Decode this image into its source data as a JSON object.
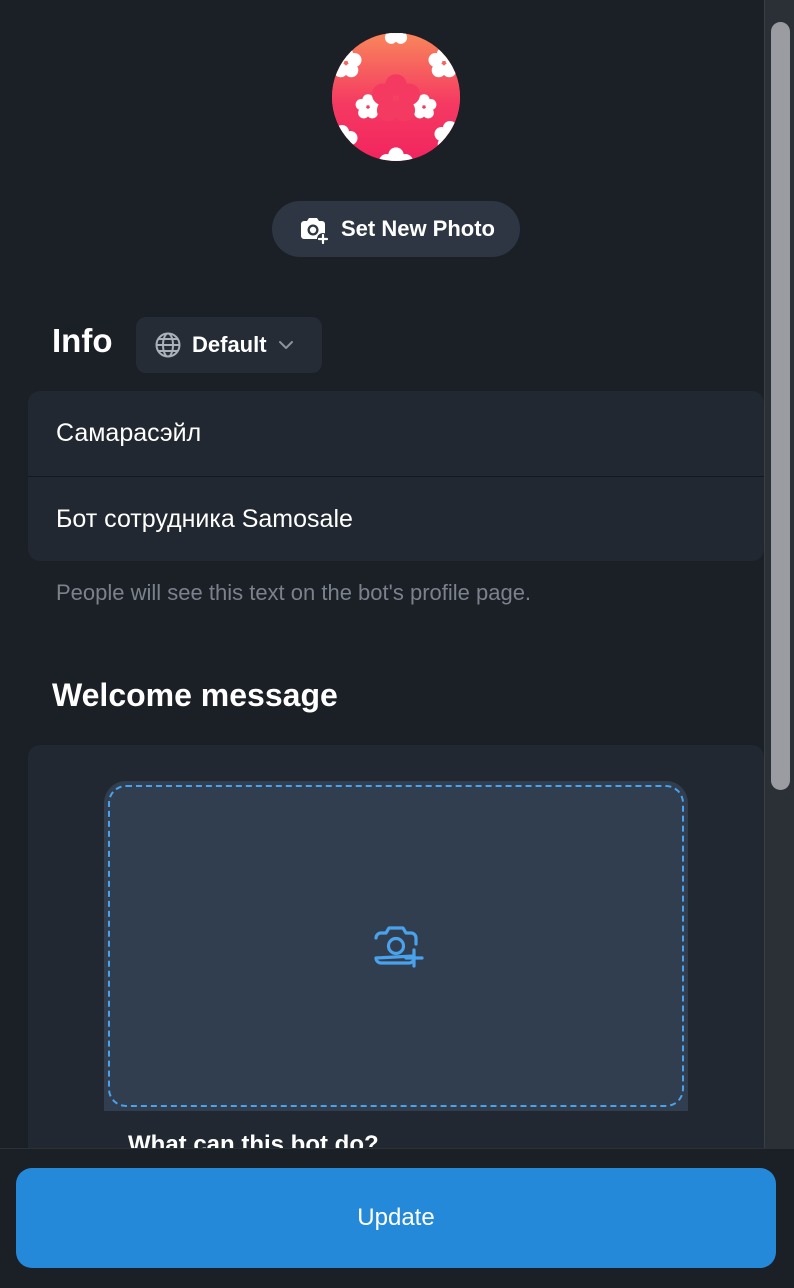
{
  "profile": {
    "set_photo_label": "Set New Photo"
  },
  "info": {
    "title": "Info",
    "language": "Default",
    "name": "Самарасэйл",
    "description": "Бот сотрудника Samosale",
    "hint": "People will see this text on the bot's profile page."
  },
  "welcome": {
    "title": "Welcome message",
    "preview_caption": "What can this bot do?"
  },
  "footer": {
    "update_label": "Update"
  },
  "colors": {
    "accent": "#2589d9",
    "dropzone_border": "#4ba2ec",
    "background": "#1b1f26"
  },
  "icons": {
    "set_photo": "camera-add-icon",
    "language": "globe-icon",
    "dropdown": "chevron-down-icon",
    "dropzone": "camera-add-icon"
  }
}
